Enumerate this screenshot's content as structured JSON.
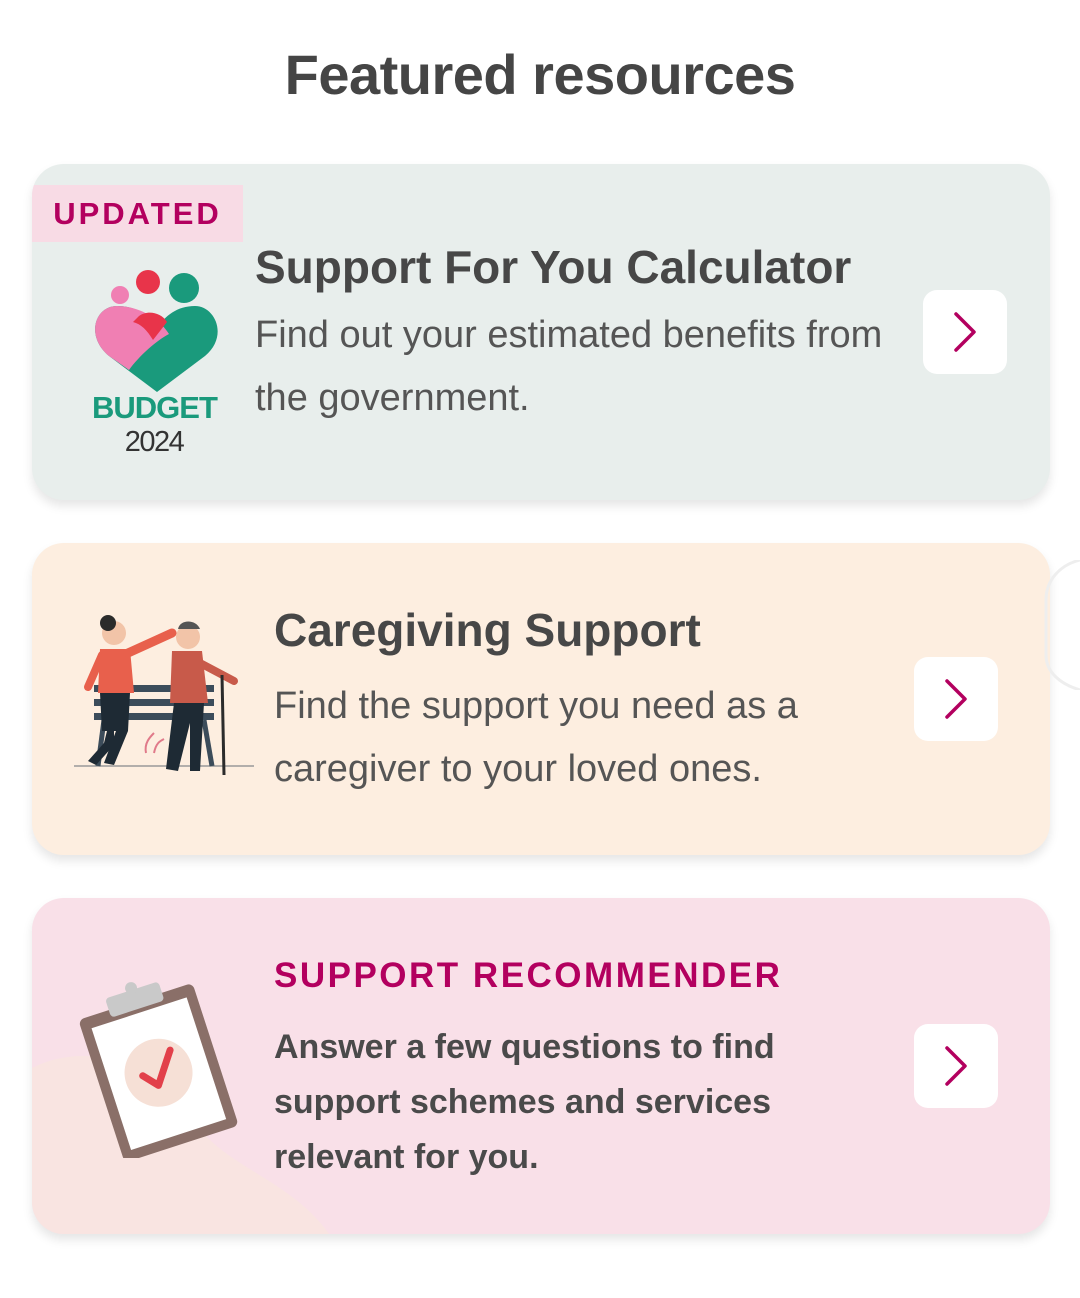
{
  "section": {
    "title": "Featured resources"
  },
  "cards": [
    {
      "badge": "UPDATED",
      "logo_text": "BUDGET",
      "logo_year": "2024",
      "title": "Support For You Calculator",
      "description": "Find out your estimated benefits from the government.",
      "illustration": "budget-2024-heart-logo",
      "arrow_icon": "chevron-right-icon",
      "background": "#e8eeec"
    },
    {
      "title": "Caregiving Support",
      "description": "Find the support you need as a caregiver to your loved ones.",
      "illustration": "caregiver-with-elderly-illustration",
      "arrow_icon": "chevron-right-icon",
      "background": "#fdeee0"
    },
    {
      "eyebrow": "SUPPORT RECOMMENDER",
      "description": "Answer a few questions to find support schemes and services relevant for you.",
      "illustration": "clipboard-checkmark-illustration",
      "arrow_icon": "chevron-right-icon",
      "background": "#f9e0e8"
    }
  ],
  "colors": {
    "accent": "#b3005f",
    "title_text": "#474747",
    "body_text": "#555555",
    "budget_green": "#1a9a7c"
  }
}
